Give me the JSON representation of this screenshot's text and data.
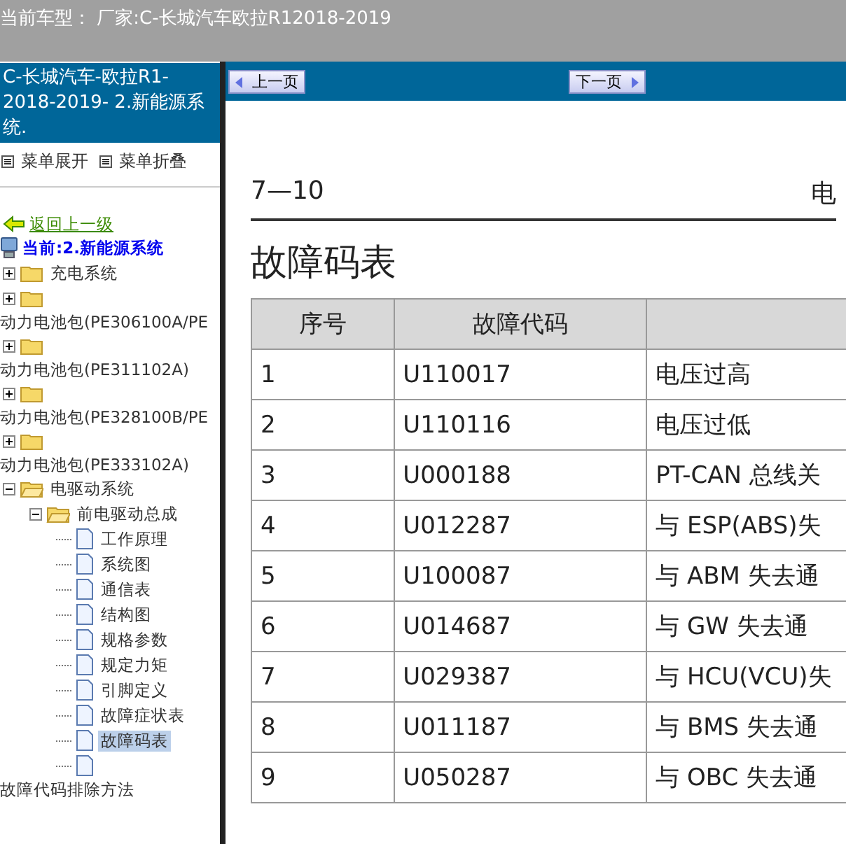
{
  "top_bar": {
    "title": "当前车型： 厂家:C-长城汽车欧拉R12018-2019"
  },
  "sidebar": {
    "header": "C-长城汽车-欧拉R1-2018-2019- 2.新能源系统.",
    "menu_actions": [
      {
        "label": "菜单展开"
      },
      {
        "label": "菜单折叠"
      }
    ],
    "back_link": "返回上一级",
    "current": "当前:2.新能源系统",
    "tree": [
      {
        "kind": "folder",
        "label": "充电系统",
        "expanded": false,
        "label_below": false
      },
      {
        "kind": "folder",
        "label": "动力电池包(PE306100A/PE",
        "expanded": false,
        "label_below": true
      },
      {
        "kind": "folder",
        "label": "动力电池包(PE311102A)",
        "expanded": false,
        "label_below": true
      },
      {
        "kind": "folder",
        "label": "动力电池包(PE328100B/PE",
        "expanded": false,
        "label_below": true
      },
      {
        "kind": "folder",
        "label": "动力电池包(PE333102A)",
        "expanded": false,
        "label_below": true
      },
      {
        "kind": "folder",
        "label": "电驱动系统",
        "expanded": true,
        "label_below": false,
        "children": [
          {
            "kind": "folder",
            "label": "前电驱动总成",
            "expanded": true,
            "label_below": false,
            "children": [
              {
                "kind": "doc",
                "label": "工作原理",
                "selected": false,
                "label_below": false
              },
              {
                "kind": "doc",
                "label": "系统图",
                "selected": false,
                "label_below": false
              },
              {
                "kind": "doc",
                "label": "通信表",
                "selected": false,
                "label_below": false
              },
              {
                "kind": "doc",
                "label": "结构图",
                "selected": false,
                "label_below": false
              },
              {
                "kind": "doc",
                "label": "规格参数",
                "selected": false,
                "label_below": false
              },
              {
                "kind": "doc",
                "label": "规定力矩",
                "selected": false,
                "label_below": false
              },
              {
                "kind": "doc",
                "label": "引脚定义",
                "selected": false,
                "label_below": false
              },
              {
                "kind": "doc",
                "label": "故障症状表",
                "selected": false,
                "label_below": false
              },
              {
                "kind": "doc",
                "label": "故障码表",
                "selected": true,
                "label_below": false
              },
              {
                "kind": "doc",
                "label": "故障代码排除方法",
                "selected": false,
                "label_below": true
              }
            ]
          }
        ]
      }
    ]
  },
  "nav": {
    "prev": "上一页",
    "next": "下一页"
  },
  "document": {
    "page_number": "7—10",
    "header_right": "电",
    "title": "故障码表",
    "table": {
      "columns": [
        "序号",
        "故障代码"
      ],
      "rows": [
        [
          "1",
          "U110017",
          "电压过高"
        ],
        [
          "2",
          "U110116",
          "电压过低"
        ],
        [
          "3",
          "U000188",
          "PT-CAN 总线关"
        ],
        [
          "4",
          "U012287",
          "与 ESP(ABS)失"
        ],
        [
          "5",
          "U100087",
          "与 ABM 失去通"
        ],
        [
          "6",
          "U014687",
          "与 GW 失去通"
        ],
        [
          "7",
          "U029387",
          "与 HCU(VCU)失"
        ],
        [
          "8",
          "U011187",
          "与 BMS 失去通"
        ],
        [
          "9",
          "U050287",
          "与 OBC 失去通"
        ]
      ]
    }
  }
}
